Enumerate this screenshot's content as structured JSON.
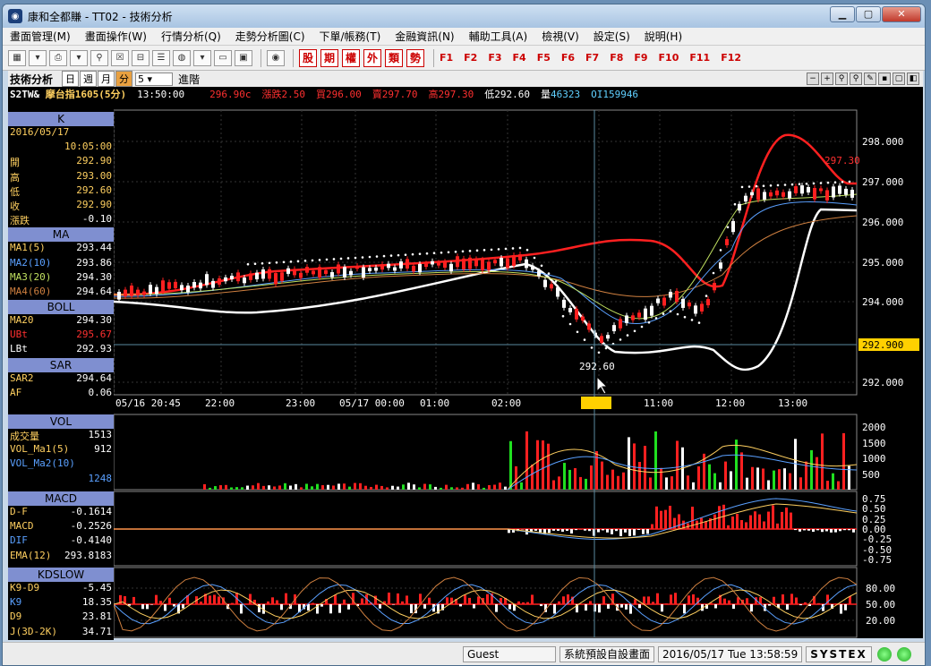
{
  "window": {
    "title": "康和全都賺 - TT02 - 技術分析",
    "min": "▁",
    "max": "▢",
    "close": "✕"
  },
  "menu": [
    "畫面管理(M)",
    "畫面操作(W)",
    "行情分析(Q)",
    "走勢分析圖(C)",
    "下單/帳務(T)",
    "金融資訊(N)",
    "輔助工具(A)",
    "檢視(V)",
    "設定(S)",
    "說明(H)"
  ],
  "toolbar": {
    "red_buttons": [
      "股",
      "期",
      "權",
      "外",
      "類",
      "勢"
    ],
    "fkeys": [
      "F1",
      "F2",
      "F3",
      "F4",
      "F5",
      "F6",
      "F7",
      "F8",
      "F9",
      "F10",
      "F11",
      "F12"
    ]
  },
  "chart_header": {
    "title": "技術分析",
    "periods": [
      "日",
      "週",
      "月",
      "分"
    ],
    "selected_period": "分",
    "interval": "5",
    "advanced": "進階"
  },
  "quote": {
    "symbol": "S2TW&",
    "name": "摩台指1605(5分)",
    "time": "13:50:00",
    "price": "296.90c",
    "change": "漲跌2.50",
    "bid": "買296.00",
    "ask": "賣297.70",
    "high": "高297.30",
    "low": "低292.60",
    "volume_label": "量",
    "volume": "46323",
    "oi": "OI159946"
  },
  "panels": {
    "k": {
      "title": "K",
      "date": "2016/05/17",
      "time": "10:05:00",
      "rows": [
        [
          "開",
          "292.90"
        ],
        [
          "高",
          "293.00"
        ],
        [
          "低",
          "292.60"
        ],
        [
          "收",
          "292.90"
        ],
        [
          "漲跌",
          "-0.10"
        ]
      ]
    },
    "ma": {
      "title": "MA",
      "rows": [
        [
          "MA1(5)",
          "293.44"
        ],
        [
          "MA2(10)",
          "293.86"
        ],
        [
          "MA3(20)",
          "294.30"
        ],
        [
          "MA4(60)",
          "294.64"
        ]
      ]
    },
    "boll": {
      "title": "BOLL",
      "rows": [
        [
          "MA20",
          "294.30"
        ],
        [
          "UBt",
          "295.67"
        ],
        [
          "LBt",
          "292.93"
        ]
      ]
    },
    "sar": {
      "title": "SAR",
      "rows": [
        [
          "SAR2",
          "294.64"
        ],
        [
          "AF",
          "0.06"
        ]
      ]
    },
    "vol": {
      "title": "VOL",
      "rows": [
        [
          "成交量",
          "1513"
        ],
        [
          "VOL_Ma1(5)",
          "912"
        ],
        [
          "VOL_Ma2(10)",
          ""
        ],
        [
          "",
          "1248"
        ]
      ]
    },
    "macd": {
      "title": "MACD",
      "rows": [
        [
          "D-F",
          "-0.1614"
        ],
        [
          "MACD",
          "-0.2526"
        ],
        [
          "DIF",
          "-0.4140"
        ],
        [
          "EMA(12)",
          "293.8183"
        ]
      ]
    },
    "kd": {
      "title": "KDSLOW",
      "rows": [
        [
          "K9-D9",
          "-5.45"
        ],
        [
          "K9",
          "18.35"
        ],
        [
          "D9",
          "23.81"
        ],
        [
          "J(3D-2K)",
          "34.71"
        ]
      ]
    }
  },
  "axes": {
    "price_ticks": [
      "298.000",
      "297.000",
      "296.000",
      "295.000",
      "294.000",
      "293.000",
      "292.000"
    ],
    "current_price_label": "292.900",
    "time_ticks": [
      "05/16 20:45",
      "22:00",
      "23:00",
      "05/17 00:00",
      "01:00",
      "02:00",
      "10:05",
      "11:00",
      "12:00",
      "13:00"
    ],
    "vol_ticks": [
      "2000",
      "1500",
      "1000",
      "500"
    ],
    "macd_ticks": [
      "0.75",
      "0.50",
      "0.25",
      "0.00",
      "-0.25",
      "-0.50",
      "-0.75"
    ],
    "kd_ticks": [
      "80.00",
      "50.00",
      "20.00"
    ],
    "low_marker": "292.60",
    "high_marker": "297.30"
  },
  "status": {
    "user": "Guest",
    "layout": "系統預設自設畫面",
    "datetime": "2016/05/17 Tue 13:58:59",
    "brand": "SYSTEX"
  },
  "colors": {
    "up": "#ff0000",
    "down": "#ffffff",
    "ubt": "#ff2020",
    "lbt": "#ffffff",
    "label": "#ffd060",
    "value": "#ffd060"
  }
}
